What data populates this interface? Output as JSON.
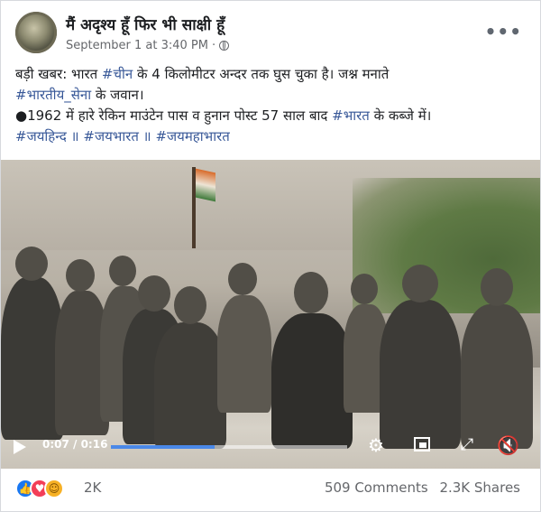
{
  "page": {
    "name": "मैं अदृश्य हूँ फिर भी साक्षी हूँ",
    "timestamp": "September 1 at 3:40 PM",
    "separator": "·",
    "privacy_icon": "globe-icon",
    "more_icon": "more-horizontal-icon"
  },
  "post": {
    "line1_prefix": "बड़ी खबर: भारत ",
    "line1_tag": "#चीन",
    "line1_suffix": " के 4 किलोमीटर अन्दर तक घुस चुका है। जश्न मनाते",
    "line2_tag": "#भारतीय_सेना",
    "line2_suffix": " के जवान।",
    "line3_prefix": "●1962 में हारे रेकिन माउंटेन पास व हुनान पोस्ट 57 साल बाद ",
    "line3_tag": "#भारत",
    "line3_suffix": " के कब्जे में।",
    "line4_tag1": "#जयहिन्द",
    "line4_sep1": " ॥ ",
    "line4_tag2": "#जयभारत",
    "line4_sep2": " ॥ ",
    "line4_tag3": "#जयमहाभारत"
  },
  "video": {
    "current_time": "0:07",
    "duration": "0:16",
    "time_display": "0:07 / 0:16",
    "progress": 0.44,
    "icons": [
      "play-icon",
      "settings-gear-icon",
      "picture-in-picture-icon",
      "fullscreen-icon",
      "volume-muted-icon"
    ]
  },
  "engagement": {
    "reactions": [
      "like",
      "love",
      "care"
    ],
    "reaction_count": "2K",
    "comments": "509 Comments",
    "shares": "2.3K Shares"
  },
  "colors": {
    "hashtag": "#385898",
    "progress": "#4a88e8",
    "like": "#1877f2",
    "love": "#f33e58",
    "care": "#f7b125"
  }
}
